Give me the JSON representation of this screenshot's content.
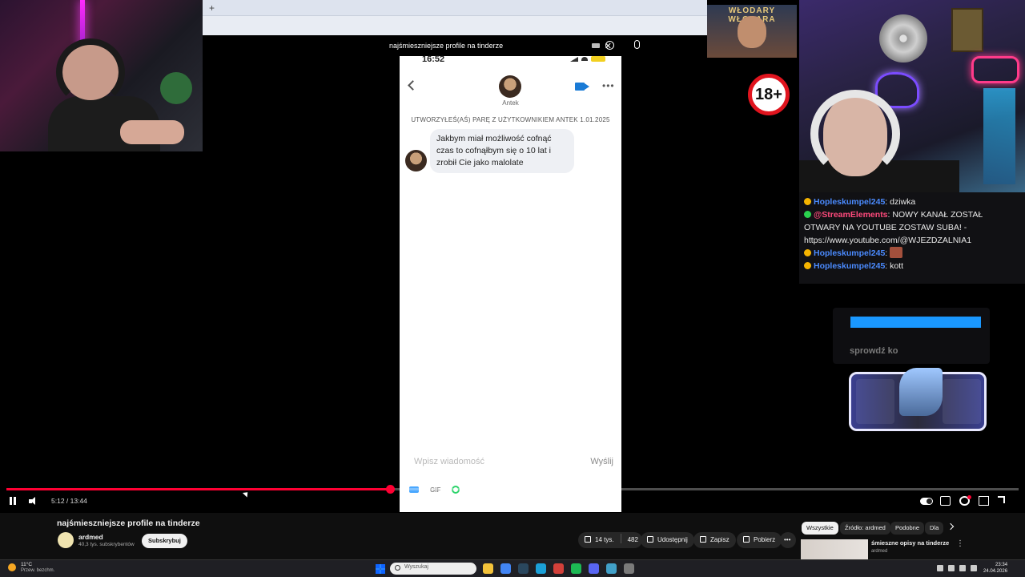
{
  "browser": {
    "new_tab": "+"
  },
  "search": {
    "query": "najśmieszniejsze profile na tinderze"
  },
  "overlay": {
    "age_badge": "18+",
    "poster_title": "WŁODARY WŁODARA",
    "promo_text": "sprowdź ko"
  },
  "chat": {
    "messages": [
      {
        "user": "Hopleskumpel245",
        "text": ": dziwka",
        "user_color": "#4b8bff",
        "badge_color": "#f5b400"
      },
      {
        "user": "@StreamElements",
        "text": ": NOWY KANAŁ ZOSTAŁ OTWARY NA YOUTUBE ZOSTAW SUBA! - https://www.youtube.com/@WJEZDZALNIA1",
        "user_color": "#ff4a7c",
        "badge_color": "#2ad14e"
      },
      {
        "user": "Hopleskumpel245",
        "text": ":",
        "user_color": "#4b8bff",
        "badge_color": "#f5b400",
        "emote": true
      },
      {
        "user": "Hopleskumpel245",
        "text": ": kott",
        "user_color": "#4b8bff",
        "badge_color": "#f5b400"
      }
    ]
  },
  "phone": {
    "time": "16:52",
    "contact_name": "Antek",
    "match_line": "UTWORZYŁEŚ(AŚ) PARĘ Z UŻYTKOWNIKIEM ANTEK 1.01.2025",
    "message": "Jakbym miał możliwość cofnąć czas to cofnąłbym się o 10 lat i zrobił Cie jako malolate",
    "compose_placeholder": "Wpisz wiadomość",
    "send_label": "Wyślij",
    "gif_label": "GIF"
  },
  "player": {
    "time": "5:12 / 13:44",
    "progress": 0.379
  },
  "video": {
    "title": "najśmieszniejsze profile na tinderze",
    "channel": "ardmed",
    "subscribers": "40,3 tys. subskrybentów",
    "subscribe_label": "Subskrybuj",
    "likes": "14 tys.",
    "dislikes": "482",
    "share_label": "Udostępnij",
    "save_label": "Zapisz",
    "download_label": "Pobierz",
    "more_label": "•••"
  },
  "chips": [
    {
      "label": "Wszystkie",
      "active": true
    },
    {
      "label": "Źródło: ardmed"
    },
    {
      "label": "Podobne"
    },
    {
      "label": "Dla"
    }
  ],
  "recommendation": {
    "title": "śmieszne opisy na tinderze",
    "channel": "ardmed",
    "menu": "⋮"
  },
  "taskbar": {
    "temperature": "11°C",
    "weather": "Przew. bezchm.",
    "search_placeholder": "Wyszukaj",
    "time": "23:34",
    "date": "24.04.2026",
    "apps": [
      {
        "name": "file-explorer",
        "color": "#f3c23a"
      },
      {
        "name": "chrome",
        "color": "#4285f4"
      },
      {
        "name": "steam",
        "color": "#2a475e"
      },
      {
        "name": "edge",
        "color": "#1ba0d8"
      },
      {
        "name": "acrobat",
        "color": "#d3403a"
      },
      {
        "name": "spotify",
        "color": "#1db954"
      },
      {
        "name": "discord",
        "color": "#5865f2"
      },
      {
        "name": "app-blue",
        "color": "#41a0c9"
      },
      {
        "name": "obs",
        "color": "#7a7a7a"
      }
    ]
  },
  "colors": {
    "accent": "#ff0033",
    "bg": "#0f0f0f"
  }
}
